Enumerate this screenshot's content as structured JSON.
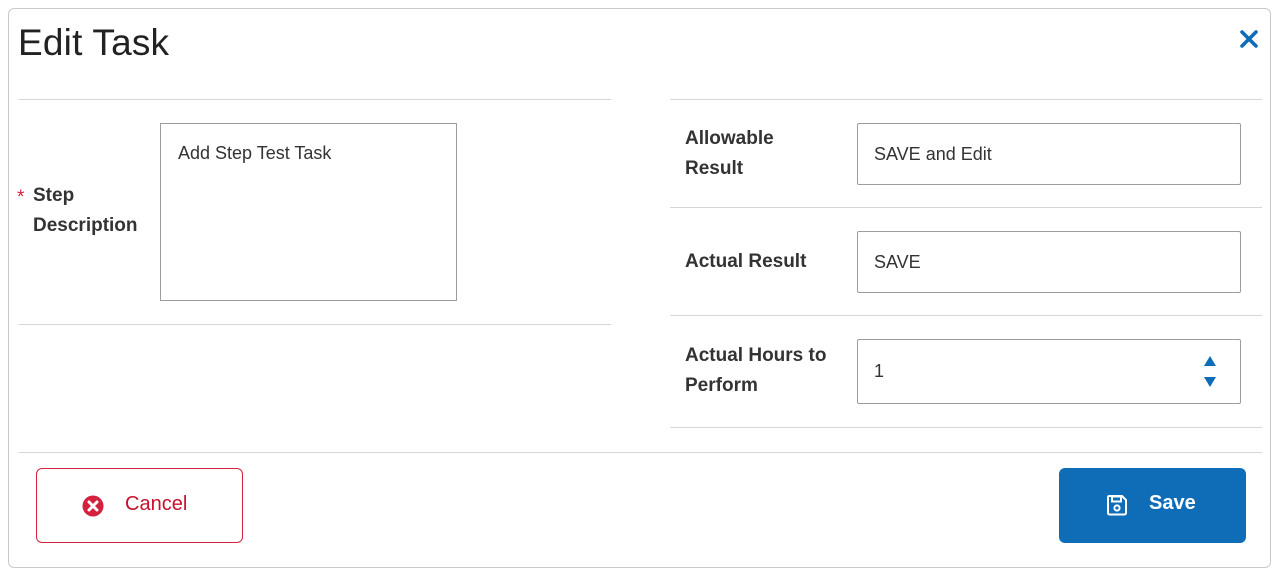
{
  "dialog": {
    "title": "Edit Task",
    "close_icon": "close-icon"
  },
  "left": {
    "required_marker": "*",
    "step_description": {
      "label_line1": "Step",
      "label_line2": "Description",
      "value": "Add Step Test Task"
    }
  },
  "right": {
    "allowable_result": {
      "label_line1": "Allowable",
      "label_line2": "Result",
      "value": "SAVE and Edit"
    },
    "actual_result": {
      "label": "Actual Result",
      "value": "SAVE"
    },
    "actual_hours": {
      "label_line1": "Actual Hours to",
      "label_line2": "Perform",
      "value": "1"
    }
  },
  "footer": {
    "cancel_label": "Cancel",
    "cancel_icon": "times-circle-icon",
    "save_label": "Save",
    "save_icon": "floppy-disk-icon"
  },
  "colors": {
    "accent": "#0f6db7",
    "danger": "#d4213d",
    "border": "#9c9c9c"
  }
}
